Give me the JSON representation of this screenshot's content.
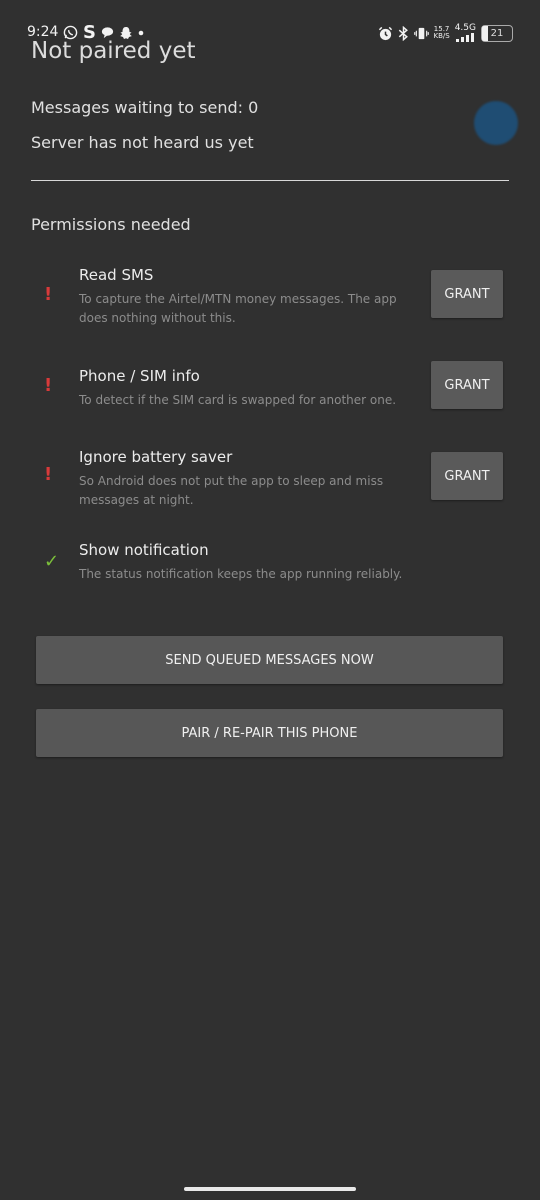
{
  "status_bar": {
    "time": "9:24",
    "icons_left": [
      "whatsapp-icon",
      "s-app-icon",
      "chat-icon",
      "snapchat-icon",
      "dot-icon"
    ],
    "speed_value": "15.7",
    "speed_unit": "KB/S",
    "network": "4.5G",
    "battery": "21"
  },
  "header": {
    "title": "Not paired yet"
  },
  "status": {
    "queue_text": "Messages waiting to send: 0",
    "server_text": "Server has not heard us yet",
    "indicator_color": "#1f4d73"
  },
  "permissions": {
    "header": "Permissions needed",
    "items": [
      {
        "mark": "!",
        "state": "missing",
        "title": "Read SMS",
        "desc": "To capture the Airtel/MTN money messages. The app does nothing without this.",
        "button": "GRANT"
      },
      {
        "mark": "!",
        "state": "missing",
        "title": "Phone / SIM info",
        "desc": "To detect if the SIM card is swapped for another one.",
        "button": "GRANT"
      },
      {
        "mark": "!",
        "state": "missing",
        "title": "Ignore battery saver",
        "desc": "So Android does not put the app to sleep and miss messages at night.",
        "button": "GRANT"
      },
      {
        "mark": "✓",
        "state": "granted",
        "title": "Show notification",
        "desc": "The status notification keeps the app running reliably."
      }
    ]
  },
  "actions": {
    "send_queued": "SEND QUEUED MESSAGES NOW",
    "pair": "PAIR / RE-PAIR THIS PHONE"
  },
  "colors": {
    "background": "#303030",
    "button": "#575757",
    "missing": "#d83a3a",
    "granted": "#7bbf3a"
  }
}
